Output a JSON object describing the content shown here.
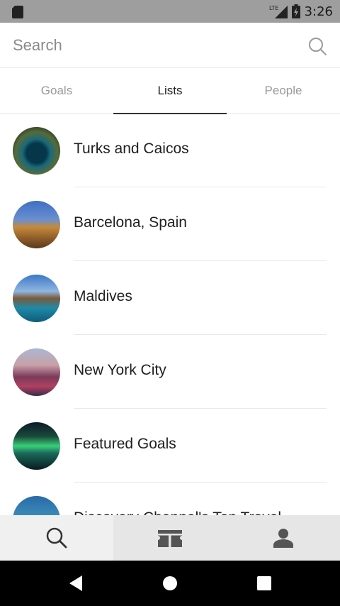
{
  "status_bar": {
    "network": "LTE",
    "time": "3:26"
  },
  "search": {
    "placeholder": "Search"
  },
  "tabs": [
    {
      "label": "Goals",
      "active": false
    },
    {
      "label": "Lists",
      "active": true
    },
    {
      "label": "People",
      "active": false
    }
  ],
  "lists": [
    {
      "label": "Turks and Caicos"
    },
    {
      "label": "Barcelona, Spain"
    },
    {
      "label": "Maldives"
    },
    {
      "label": "New York City"
    },
    {
      "label": "Featured Goals"
    },
    {
      "label": "Discovery Channel's Top Travel"
    }
  ],
  "bottom_nav": [
    {
      "icon": "search-icon",
      "active": true
    },
    {
      "icon": "tickets-icon",
      "active": false
    },
    {
      "icon": "person-icon",
      "active": false
    }
  ],
  "system_nav": [
    "back-icon",
    "home-icon",
    "recents-icon"
  ]
}
